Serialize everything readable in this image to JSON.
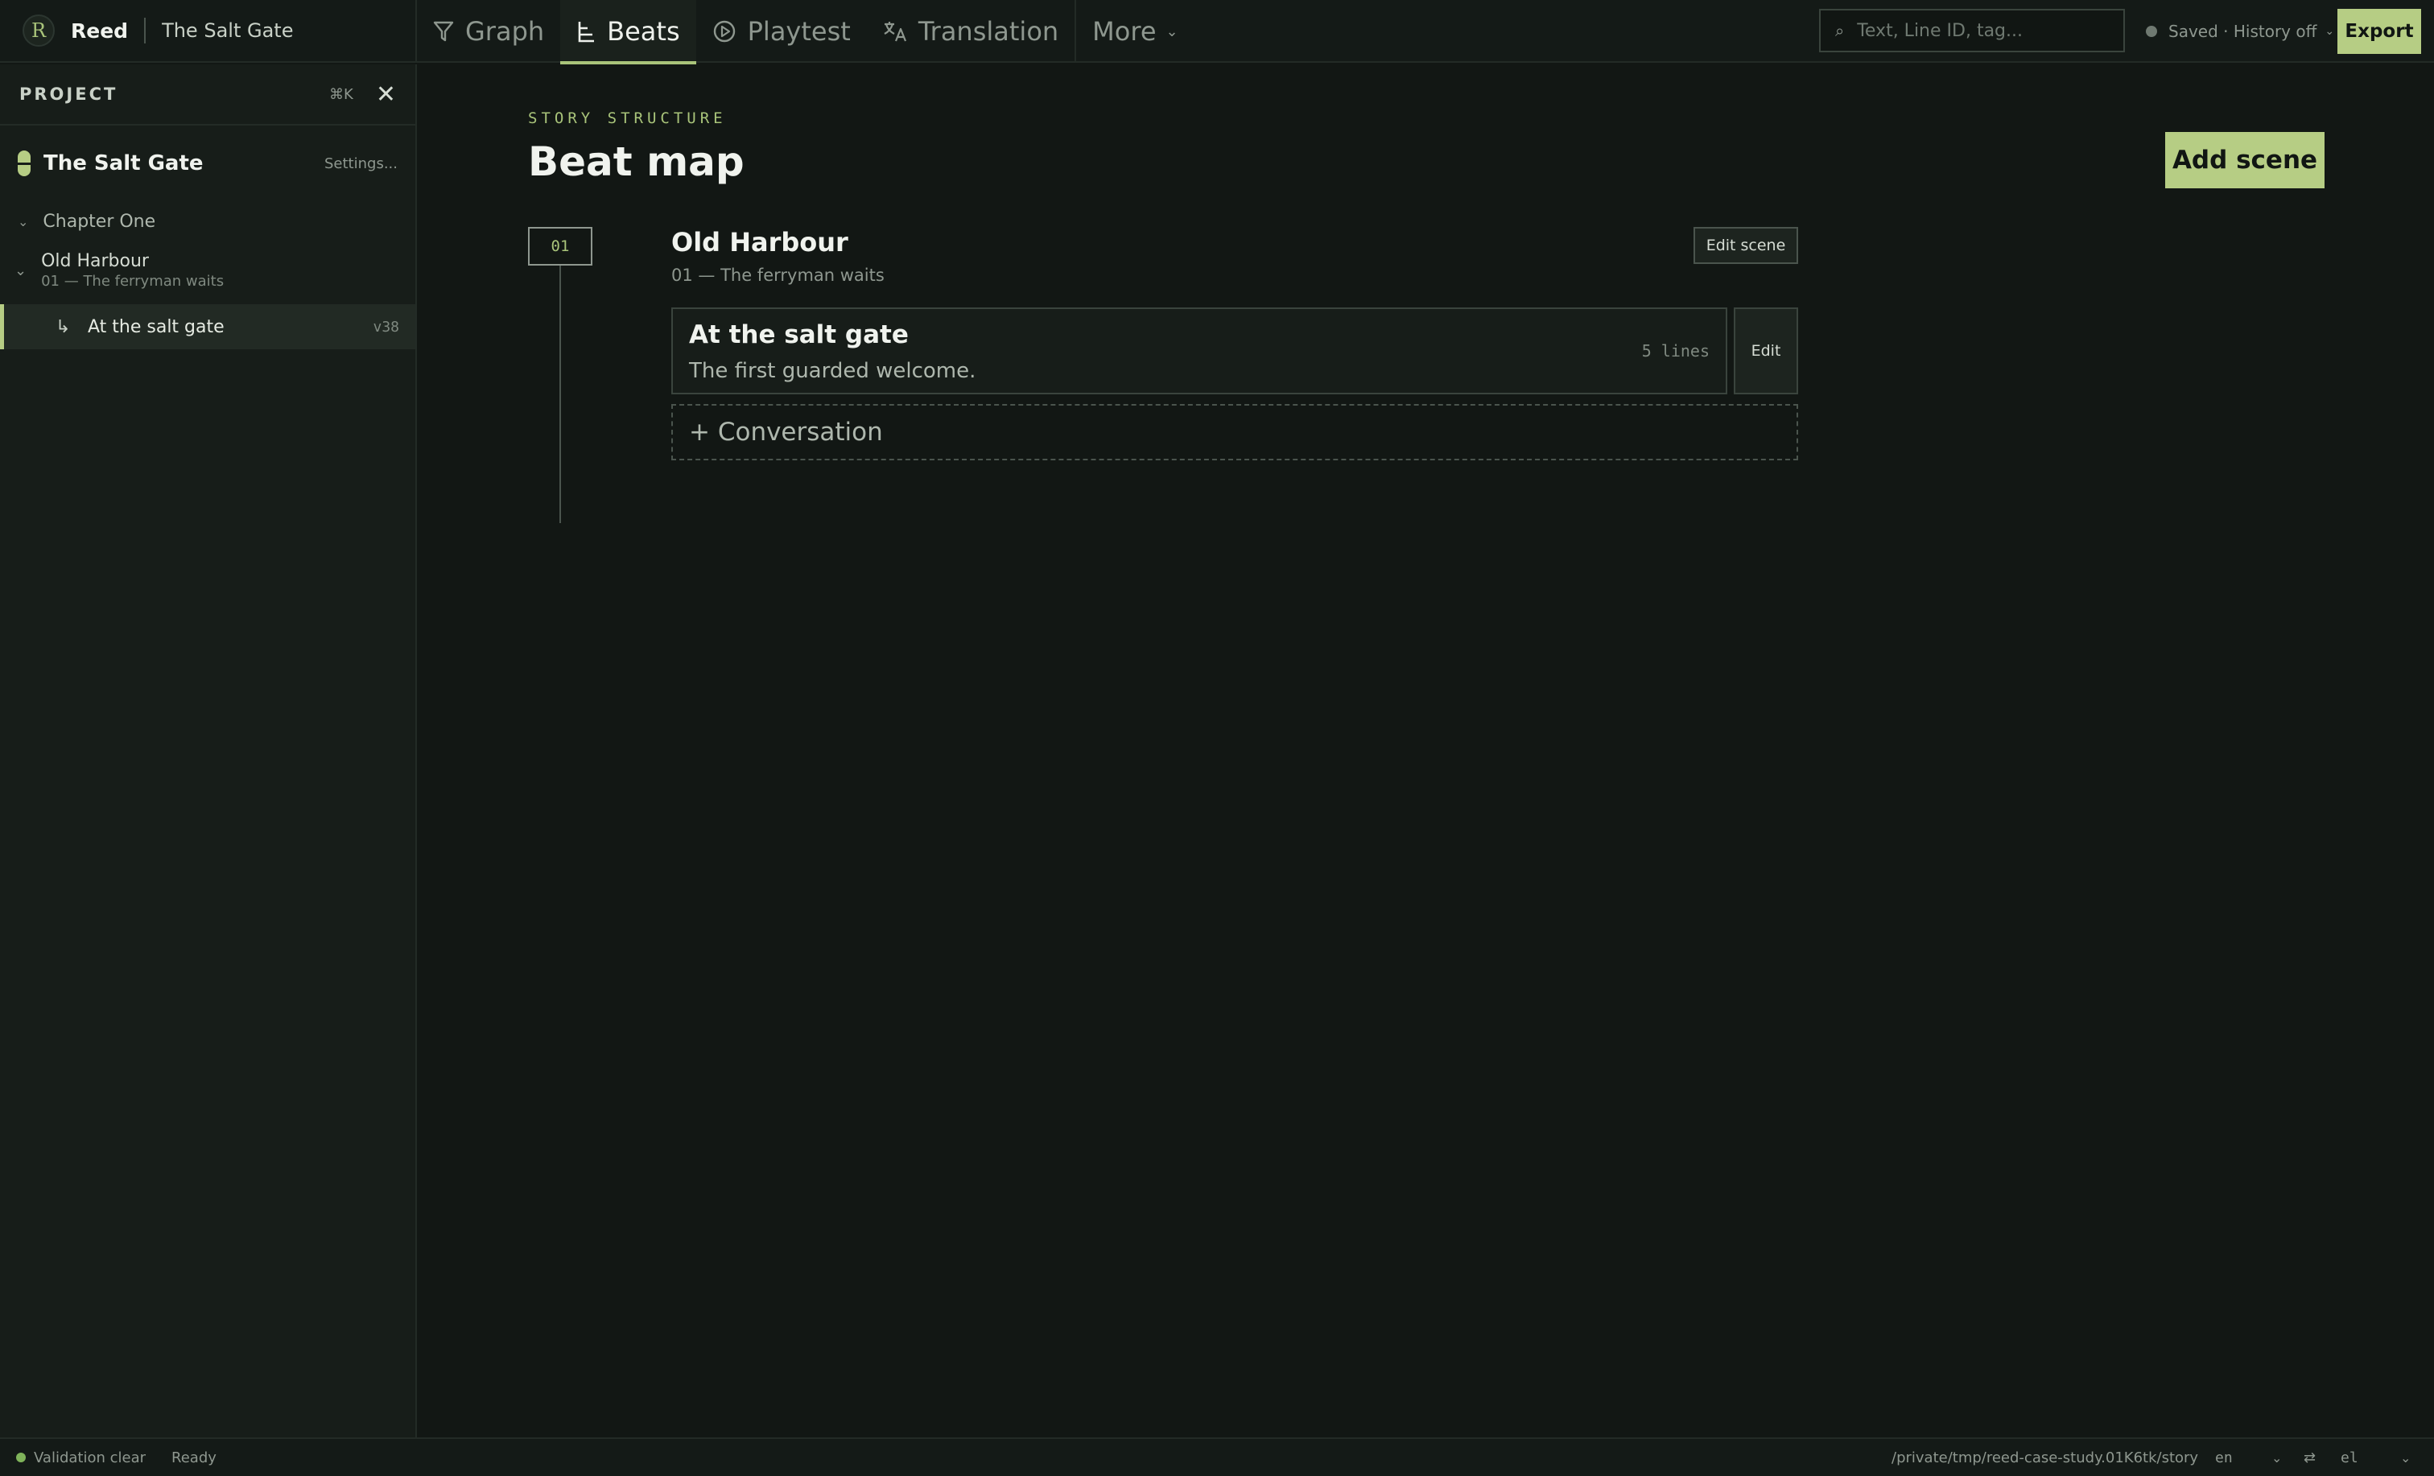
{
  "app": {
    "name": "Reed",
    "logo_glyph": "R",
    "project": "The Salt Gate"
  },
  "nav": {
    "tabs": [
      {
        "label": "Graph",
        "icon": "filter-icon"
      },
      {
        "label": "Beats",
        "icon": "beats-icon",
        "active": true
      },
      {
        "label": "Playtest",
        "icon": "play-circle-icon"
      },
      {
        "label": "Translation",
        "icon": "translate-icon"
      }
    ],
    "more_label": "More",
    "more_chevron": "⌄"
  },
  "search": {
    "glyph": "⌕",
    "placeholder": "Text, Line ID, tag..."
  },
  "save_status": {
    "text": "Saved · History off",
    "chevron": "⌄"
  },
  "export_label": "Export",
  "sidebar": {
    "title": "PROJECT",
    "shortcut": "⌘K",
    "close_glyph": "✕",
    "project_name": "The Salt Gate",
    "settings_label": "Settings...",
    "chapter": {
      "chevron": "⌄",
      "label": "Chapter One"
    },
    "scene": {
      "chevron": "⌄",
      "title": "Old Harbour",
      "subtitle": "01 — The ferryman waits"
    },
    "conversation": {
      "arrow": "↳",
      "label": "At the salt gate",
      "version": "v38"
    }
  },
  "main": {
    "eyebrow": "STORY STRUCTURE",
    "title": "Beat map",
    "add_scene_label": "Add scene",
    "scene": {
      "number": "01",
      "title": "Old Harbour",
      "subtitle": "01 — The ferryman waits",
      "edit_label": "Edit scene",
      "conversation": {
        "title": "At the salt gate",
        "description": "The first guarded welcome.",
        "lines": "5 lines",
        "edit_label": "Edit"
      }
    },
    "add_conversation_label": "+ Conversation"
  },
  "status": {
    "validation": "Validation clear",
    "state": "Ready",
    "path": "/private/tmp/reed-case-study.01K6tk/story",
    "source_lang": "en",
    "source_chevron": "⌄",
    "swap_glyph": "⇄",
    "target_lang": "el",
    "target_chevron": "⌄"
  },
  "colors": {
    "accent": "#b6cd84",
    "background": "#121714",
    "sidebar": "#171d19",
    "validation_ok": "#7fb35a"
  }
}
